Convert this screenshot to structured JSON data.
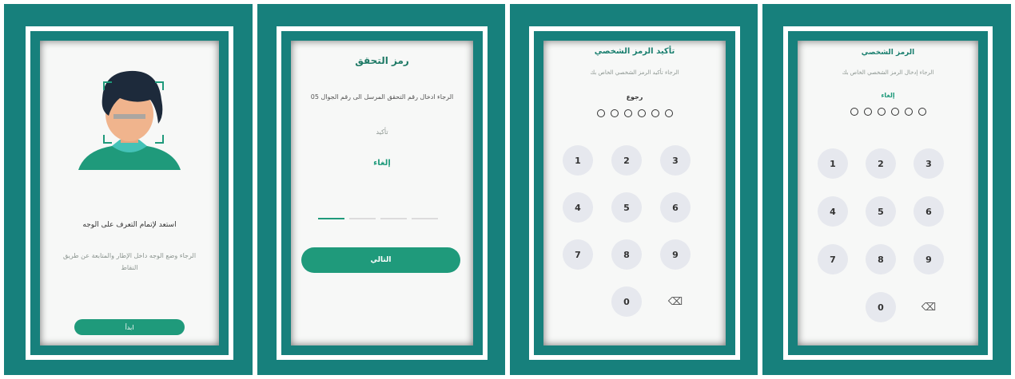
{
  "screen1": {
    "title": "استعد لإتمام التعرف على الوجه",
    "description": "الرجاء وضع الوجه داخل الإطار والمتابعة عن طريق النقاط",
    "start_button": "ابدأ"
  },
  "screen2": {
    "title": "رمز التحقق",
    "description": "الرجاء ادخال رقم التحقق المرسل الى رقم الجوال 05",
    "resend": "تأكيد",
    "cancel": "إلغاء",
    "next_button": "التالي"
  },
  "screen3": {
    "title": "تأكيد الرمز الشخصي",
    "description": "الرجاء تأكيد الرمز الشخصي الخاص بك",
    "back": "رجوع",
    "keys": [
      "1",
      "2",
      "3",
      "4",
      "5",
      "6",
      "7",
      "8",
      "9",
      "",
      "0",
      "⌫"
    ]
  },
  "screen4": {
    "title": "الرمز الشخصي",
    "description": "الرجاء إدخال الرمز الشخصي الخاص بك",
    "cancel": "إلغاء",
    "keys": [
      "1",
      "2",
      "3",
      "4",
      "5",
      "6",
      "7",
      "8",
      "9",
      "",
      "0",
      "⌫"
    ]
  },
  "colors": {
    "teal": "#17807c",
    "accent": "#1f9a7b",
    "key_bg": "#e6e8ee"
  }
}
